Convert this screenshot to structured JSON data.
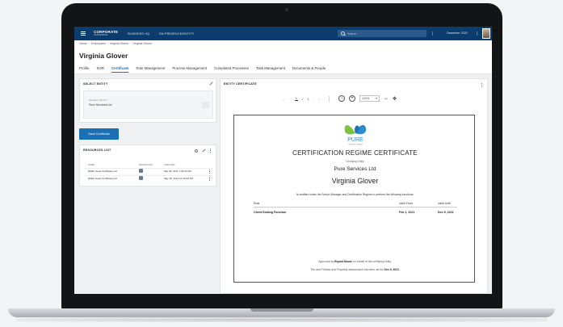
{
  "header": {
    "logo": "CORPORATE",
    "logo_sub": "ASSURANCE",
    "nav": [
      "BUSINESS HQ",
      "SM PRESENCE/ENTITY",
      ""
    ],
    "search_placeholder": "Search",
    "date": "December 2020"
  },
  "breadcrumb": [
    "Home",
    "Employees",
    "Virginia Glover",
    "Virginia Glover"
  ],
  "page_title": "Virginia Glover",
  "tabs": [
    {
      "label": "Profile",
      "active": false
    },
    {
      "label": "SOR",
      "active": false
    },
    {
      "label": "Certificate",
      "active": true
    },
    {
      "label": "Role Management",
      "active": false
    },
    {
      "label": "Process Management",
      "active": false
    },
    {
      "label": "Completed Processes",
      "active": false
    },
    {
      "label": "Task Management",
      "active": false
    },
    {
      "label": "Documents & People",
      "active": false
    }
  ],
  "select_entity": {
    "title": "SELECT ENTITY",
    "label": "SELECT ENTITY",
    "value": "Pure Services Ltd"
  },
  "save_button": "Save Certificate",
  "resources": {
    "title": "RESOURCES LIST",
    "columns": [
      "NAME",
      "DOWNLOAD",
      "CREATED"
    ],
    "rows": [
      {
        "name": "EMRL Issue Certificate.pdf",
        "created": "Mar 05, 2021 7:32:25 AM"
      },
      {
        "name": "EMRL Issue Certificate.pdf",
        "created": "May 18, 2021 10:18:43 AM"
      }
    ]
  },
  "certificate_panel": {
    "title": "ENTITY CERTIFICATE",
    "page_current": "1",
    "page_total": "1",
    "zoom": "131%"
  },
  "certificate": {
    "logo_text": "PURE",
    "logo_sub": "Services Limited",
    "heading": "CERTIFICATION REGIME CERTIFICATE",
    "certifying_label": "Certifying Entity",
    "company": "Pure Services Ltd",
    "person": "Virginia Glover",
    "statement": "Is certified under the Senior Manager and Certification Regime to perform the following functions:",
    "table_headers": [
      "Role",
      "Valid From",
      "Valid Until"
    ],
    "table_rows": [
      {
        "role": "Client Dealing Function",
        "from": "Feb 1, 2021",
        "until": "Dec 9, 2021"
      }
    ],
    "approved_prefix": "Approved by",
    "approver": "Bryant Moore",
    "approved_suffix": "on behalf of the certifying entity.",
    "fitness_prefix": "The next Fitness and Propriety assessment has been set for",
    "fitness_date": "Dec 9, 2021",
    "fitness_suffix": "."
  },
  "colors": {
    "topbar": "#0c3c6e",
    "accent": "#1a6fb5",
    "logo_blue": "#2a8bd0",
    "logo_green": "#7cc242"
  }
}
